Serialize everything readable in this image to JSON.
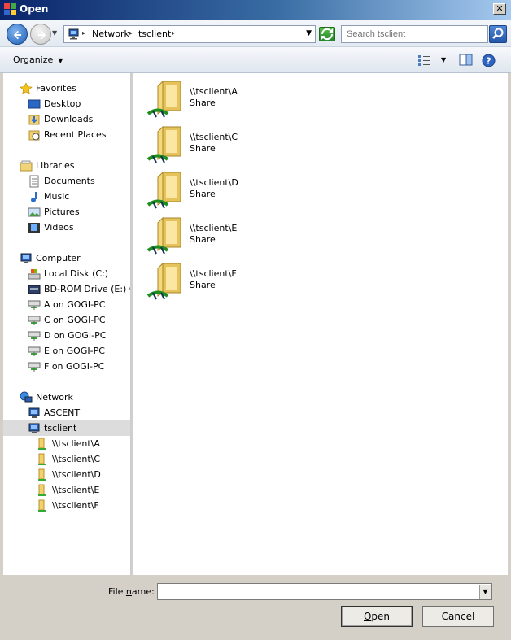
{
  "window": {
    "title": "Open"
  },
  "address": {
    "crumbs": [
      "Network",
      "tsclient"
    ]
  },
  "search": {
    "placeholder": "Search tsclient"
  },
  "toolbar": {
    "organize_label": "Organize"
  },
  "nav": {
    "favorites": {
      "label": "Favorites",
      "items": [
        "Desktop",
        "Downloads",
        "Recent Places"
      ]
    },
    "libraries": {
      "label": "Libraries",
      "items": [
        "Documents",
        "Music",
        "Pictures",
        "Videos"
      ]
    },
    "computer": {
      "label": "Computer",
      "items": [
        "Local Disk (C:)",
        "BD-ROM Drive (E:) CD",
        "A on GOGI-PC",
        "C on GOGI-PC",
        "D on GOGI-PC",
        "E on GOGI-PC",
        "F on GOGI-PC"
      ]
    },
    "network": {
      "label": "Network",
      "items": [
        "ASCENT",
        "tsclient"
      ]
    },
    "tsclient_children": [
      "\\\\tsclient\\A",
      "\\\\tsclient\\C",
      "\\\\tsclient\\D",
      "\\\\tsclient\\E",
      "\\\\tsclient\\F"
    ],
    "selected": "tsclient"
  },
  "files": [
    {
      "name": "\\\\tsclient\\A",
      "type": "Share"
    },
    {
      "name": "\\\\tsclient\\C",
      "type": "Share"
    },
    {
      "name": "\\\\tsclient\\D",
      "type": "Share"
    },
    {
      "name": "\\\\tsclient\\E",
      "type": "Share"
    },
    {
      "name": "\\\\tsclient\\F",
      "type": "Share"
    }
  ],
  "bottom": {
    "file_name_label_pre": "File ",
    "file_name_label_ul": "n",
    "file_name_label_post": "ame:",
    "file_name_value": "",
    "open_ul": "O",
    "open_rest": "pen",
    "cancel_label": "Cancel"
  },
  "icons": {
    "back": "back-arrow-icon",
    "forward": "forward-arrow-icon",
    "refresh": "refresh-icon",
    "search": "search-icon",
    "views": "views-icon",
    "preview": "preview-pane-icon",
    "help": "help-icon"
  }
}
